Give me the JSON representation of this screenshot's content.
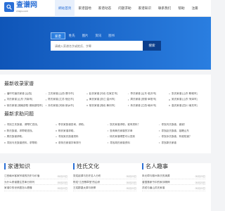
{
  "brand": {
    "name": "查谱网",
    "domain": "chapu.com"
  },
  "nav": [
    "網站首頁",
    "家谱园地",
    "家谱动态",
    "问题求助",
    "家谱知识",
    "联系我们",
    "帮助",
    "注册"
  ],
  "search": {
    "tabs": [
      "家谱",
      "姓氏",
      "图片",
      "资讯",
      "图书"
    ],
    "placeholder": "请输入家谱名字或姓氏、字辈",
    "button": "搜索"
  },
  "latest": {
    "title": "最新收录家谱",
    "items": [
      "潘环村潘氏家谱 [山西]",
      "王氏家谱 [山西·晋中市]",
      "赵氏家谱 [河北·石家庄市]",
      "李氏家谱 [山东·临沂市]",
      "张氏家谱 [山东·聊城市]",
      "刘氏家谱 [山东·济南市]",
      "陈氏家谱 [江苏·宿迁市]",
      "黄氏家谱 [浙江·温州市]",
      "周氏家谱 [安徽·阜阳市]",
      "吴氏家谱 [山东·菏泽市]",
      "徐氏家谱 [湖南邵阳·湖南邵阳市]",
      "孙氏家谱 [河南·新乡市]",
      "胡氏家谱 [湖北·黄冈市]",
      "朱氏家谱 [江西·赣州市]",
      "高氏家谱 [四川·南充市]",
      "林氏家谱 [广东·汕头市]",
      "何氏家谱 [广西·玉林市]",
      "郭氏家谱 [河南·开封市]",
      "马氏家谱 [辽宁·沈阳市]",
      "罗氏家谱 [云南·昆明市]"
    ]
  },
  "sought": {
    "title": "最新求助问题",
    "items": [
      "寻找王氏族谱，请帮忙查找。",
      "李氏家族谱查询，求助。",
      "张氏家谱求助，谁有资料？",
      "寻找刘氏族谱，谢谢！",
      "陈氏族谱，求帮助查找。",
      "杨氏家谱求助。",
      "查询黄氏家谱的字辈",
      "寻找赵氏族谱，祖籍山东",
      "周氏族谱求助。",
      "寻找吴氏族谱资料",
      "徐氏家谱哪里可以查到",
      "寻找孙氏族谱，有谁知道？",
      "寻找马氏族谱资料，求帮助",
      "求朱氏家谱字辈排行",
      "寻找胡氏家谱资料",
      "寻找郭氏家谱"
    ]
  },
  "knowledge": {
    "title": "家谱知识",
    "items": [
      {
        "text": "江西赣州客家宗谱的历史与价值",
        "date": "05月23日"
      },
      {
        "text": "为什么修谱要注意辈分排列",
        "date": "05月23日"
      },
      {
        "text": "家谱中的世系图怎么看懂",
        "date": "05月22日"
      }
    ]
  },
  "surname": {
    "title": "姓氏文化",
    "items": [
      {
        "text": "张姓起源与历史名人分布",
        "date": "05月23日"
      },
      {
        "text": "陈姓“江西豫章堂”的由来",
        "date": "05月23日"
      },
      {
        "text": "王姓郡望太原与琅琊",
        "date": "05月22日"
      }
    ]
  },
  "famous": {
    "title": "名人趣事",
    "items": [
      {
        "text": "朱元璋与徽州朱氏的渊源",
        "date": "05月23日"
      },
      {
        "text": "曾国藩家书中的家训精神",
        "date": "05月23日"
      },
      {
        "text": "苏轼与眉山苏氏家谱",
        "date": "05月22日"
      }
    ]
  }
}
